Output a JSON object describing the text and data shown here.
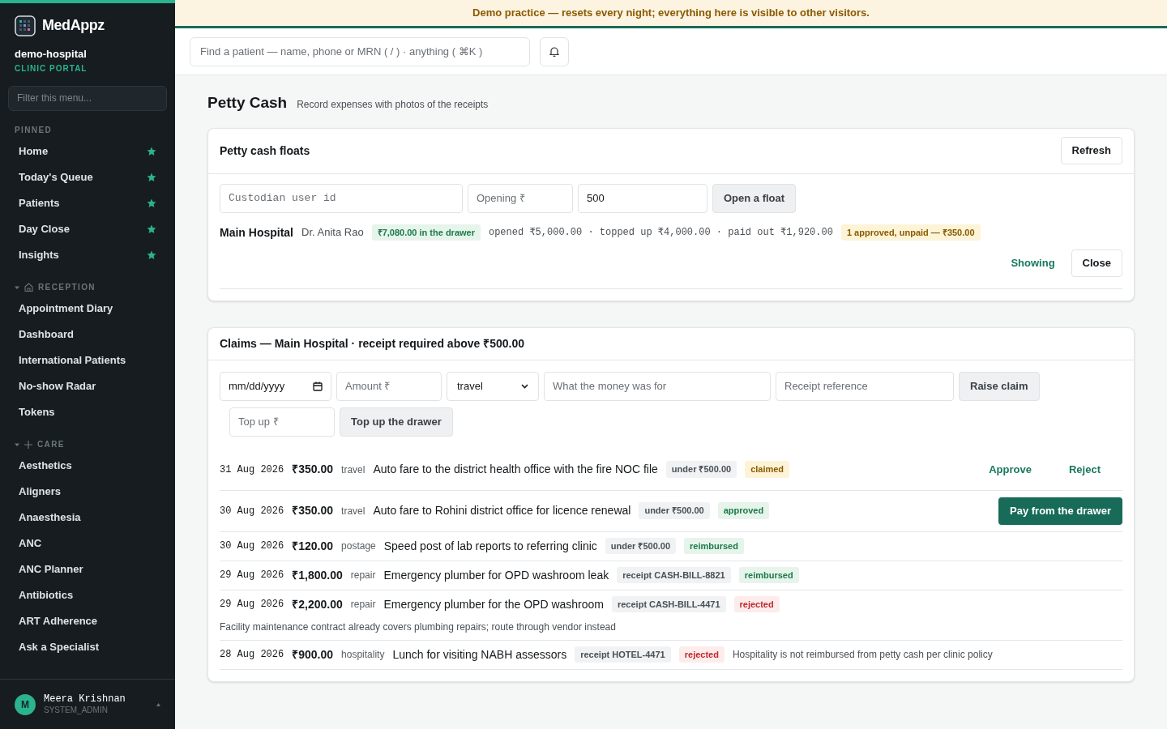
{
  "banner": "Demo practice — resets every night; everything here is visible to other visitors.",
  "sidebar": {
    "brand": "MedAppz",
    "tenant": "demo-hospital",
    "portal": "CLINIC PORTAL",
    "filter": {
      "placeholder": "Filter this menu..."
    },
    "sections": [
      {
        "title": "PINNED",
        "kind": "pinned",
        "items": [
          {
            "label": "Home",
            "starred": true
          },
          {
            "label": "Today's Queue",
            "starred": true
          },
          {
            "label": "Patients",
            "starred": true
          },
          {
            "label": "Day Close",
            "starred": true
          },
          {
            "label": "Insights",
            "starred": true
          }
        ]
      },
      {
        "title": "RECEPTION",
        "kind": "reception",
        "expanded": true,
        "items": [
          {
            "label": "Appointment Diary",
            "starred": false
          },
          {
            "label": "Dashboard",
            "starred": false
          },
          {
            "label": "International Patients",
            "starred": false
          },
          {
            "label": "No-show Radar",
            "starred": false
          },
          {
            "label": "Tokens",
            "starred": false
          }
        ]
      },
      {
        "title": "CARE",
        "kind": "care",
        "expanded": true,
        "items": [
          {
            "label": "Aesthetics",
            "starred": false
          },
          {
            "label": "Aligners",
            "starred": false
          },
          {
            "label": "Anaesthesia",
            "starred": false
          },
          {
            "label": "ANC",
            "starred": false
          },
          {
            "label": "ANC Planner",
            "starred": false
          },
          {
            "label": "Antibiotics",
            "starred": false
          },
          {
            "label": "ART Adherence",
            "starred": false
          },
          {
            "label": "Ask a Specialist",
            "starred": false
          }
        ]
      }
    ],
    "user": {
      "initial": "M",
      "name": "Meera Krishnan",
      "role": "SYSTEM_ADMIN"
    }
  },
  "search": {
    "placeholder": "Find a patient — name, phone or MRN ( / ) · anything ( ⌘K )"
  },
  "page": {
    "title": "Petty Cash",
    "subtitle": "Record expenses with photos of the receipts"
  },
  "floats": {
    "title": "Petty cash floats",
    "refresh": "Refresh",
    "form": {
      "custodian_placeholder": "Custodian user id",
      "opening_placeholder": "Opening ₹",
      "amount_value": "500",
      "button": "Open a float"
    },
    "float": {
      "site": "Main Hospital",
      "custodian": "Dr. Anita Rao",
      "balance": "₹7,080.00 in the drawer",
      "summary": "opened ₹5,000.00 · topped up ₹4,000.00 · paid out ₹1,920.00",
      "pending": "1 approved, unpaid — ₹350.00",
      "showing": "Showing",
      "close": "Close"
    }
  },
  "claims": {
    "title": "Claims — Main Hospital · receipt required above ₹500.00",
    "form": {
      "date_placeholder": "mm/dd/yyyy",
      "amount_placeholder": "Amount ₹",
      "category": "travel",
      "purpose_placeholder": "What the money was for",
      "receipt_placeholder": "Receipt reference",
      "raise": "Raise claim",
      "topup_placeholder": "Top up ₹",
      "topup": "Top up the drawer"
    },
    "rows": [
      {
        "date": "31 Aug 2026",
        "amount": "₹350.00",
        "category": "travel",
        "description": "Auto fare to the district health office with the fire NOC file",
        "receipt": "under ₹500.00",
        "status": "claimed",
        "actions": [
          {
            "label": "Approve",
            "kind": "link"
          },
          {
            "label": "Reject",
            "kind": "link"
          }
        ]
      },
      {
        "date": "30 Aug 2026",
        "amount": "₹350.00",
        "category": "travel",
        "description": "Auto fare to Rohini district office for licence renewal",
        "receipt": "under ₹500.00",
        "status": "approved",
        "actions": [
          {
            "label": "Pay from the drawer",
            "kind": "primary"
          }
        ]
      },
      {
        "date": "30 Aug 2026",
        "amount": "₹120.00",
        "category": "postage",
        "description": "Speed post of lab reports to referring clinic",
        "receipt": "under ₹500.00",
        "status": "reimbursed"
      },
      {
        "date": "29 Aug 2026",
        "amount": "₹1,800.00",
        "category": "repair",
        "description": "Emergency plumber for OPD washroom leak",
        "receipt": "receipt CASH-BILL-8821",
        "status": "reimbursed"
      },
      {
        "date": "29 Aug 2026",
        "amount": "₹2,200.00",
        "category": "repair",
        "description": "Emergency plumber for the OPD washroom",
        "receipt": "receipt CASH-BILL-4471",
        "status": "rejected",
        "detail": "Facility maintenance contract already covers plumbing repairs; route through vendor instead"
      },
      {
        "date": "28 Aug 2026",
        "amount": "₹900.00",
        "category": "hospitality",
        "description": "Lunch for visiting NABH assessors",
        "receipt": "receipt HOTEL-4471",
        "status": "rejected",
        "note": "Hospitality is not reimbursed from petty cash per clinic policy"
      }
    ]
  }
}
